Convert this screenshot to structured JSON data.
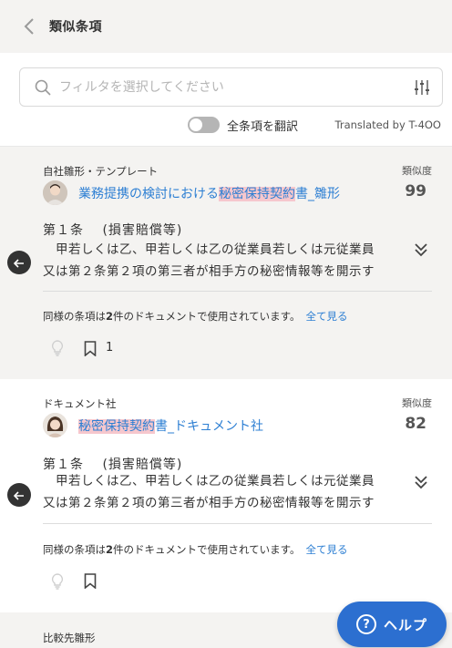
{
  "header": {
    "title": "類似条項"
  },
  "search": {
    "placeholder": "フィルタを選択してください"
  },
  "translate": {
    "toggle_label": "全条項を翻訳",
    "translated_by": "Translated by T-4OO",
    "enabled": false
  },
  "results": [
    {
      "source": "自社雛形・テンプレート",
      "similarity_label": "類似度",
      "similarity": "99",
      "doc_prefix": "業務提携の検討における",
      "doc_highlight": "秘密保持契約",
      "doc_suffix": "書_雛形",
      "clause_title": "第１条　 (損害賠償等)",
      "clause_line1": "　甲若しくは乙、甲若しくは乙の従業員若しくは元従業員",
      "clause_line2": "又は第２条第２項の第三者が相手方の秘密情報等を開示す",
      "usage_prefix": "同様の条項は",
      "usage_count": "2",
      "usage_suffix": "件のドキュメントで使用されています。",
      "see_all": "全て見る",
      "bookmark_count": "1"
    },
    {
      "source": "ドキュメント社",
      "similarity_label": "類似度",
      "similarity": "82",
      "doc_prefix": "",
      "doc_highlight": "秘密保持契約",
      "doc_suffix": "書_ドキュメント社",
      "clause_title": "第１条　 (損害賠償等)",
      "clause_line1": "　甲若しくは乙、甲若しくは乙の従業員若しくは元従業員",
      "clause_line2": "又は第２条第２項の第三者が相手方の秘密情報等を開示す",
      "usage_prefix": "同様の条項は",
      "usage_count": "2",
      "usage_suffix": "件のドキュメントで使用されています。",
      "see_all": "全て見る",
      "bookmark_count": ""
    },
    {
      "source": "比較先雛形"
    }
  ],
  "help": {
    "label": "ヘルプ",
    "icon_glyph": "?"
  },
  "colors": {
    "link": "#2d7fd3",
    "highlight": "#f6c7cd",
    "help": "#2c6fd0",
    "card_bg": "#f4f3f1"
  }
}
